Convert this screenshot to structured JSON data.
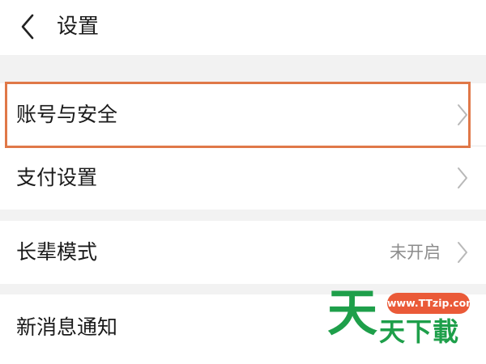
{
  "header": {
    "back_icon": "chevron-left-icon",
    "title": "设置"
  },
  "settings": {
    "account_security": {
      "label": "账号与安全",
      "icon": "chevron-right-icon"
    },
    "payment": {
      "label": "支付设置",
      "icon": "chevron-right-icon"
    },
    "elder_mode": {
      "label": "长辈模式",
      "value": "未开启",
      "icon": "chevron-right-icon"
    },
    "notifications": {
      "label": "新消息通知"
    }
  },
  "highlight": {
    "color": "#e07848",
    "target": "账号与安全"
  },
  "watermark": {
    "url": "www.TTzip.com",
    "big_char": "天",
    "brand": "天下載",
    "green": "#1e9f4a",
    "badge_color": "#ea5a38"
  }
}
